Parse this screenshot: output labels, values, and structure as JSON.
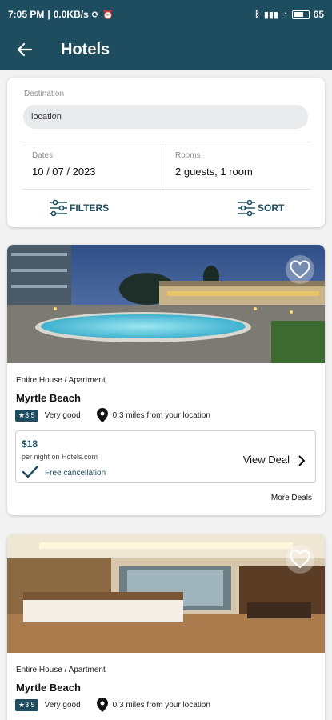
{
  "status_bar": {
    "time": "7:05 PM",
    "network_speed": "0.0KB/s",
    "battery": "65"
  },
  "app_bar": {
    "title": "Hotels",
    "back_icon": "arrow-left-icon"
  },
  "search": {
    "destination_label": "Destination",
    "destination_value": "location",
    "dates_label": "Dates",
    "dates_value": "10 / 07 / 2023",
    "rooms_label": "Rooms",
    "rooms_value": "2 guests, 1 room",
    "filters_label": "FILTERS",
    "sort_label": "SORT"
  },
  "colors": {
    "primary": "#1e4d5f",
    "background": "#f2f2f2"
  },
  "hotels": [
    {
      "type": "Entire House / Apartment",
      "name": "Myrtle Beach",
      "rating": "★3.5",
      "rating_text": "Very good",
      "distance": "0.3 miles from your location",
      "price": "$18",
      "price_sub": "per night on Hotels.com",
      "cancellation": "Free cancellation",
      "cta": "View Deal",
      "more": "More Deals"
    },
    {
      "type": "Entire House / Apartment",
      "name": "Myrtle Beach",
      "rating": "★3.5",
      "rating_text": "Very good",
      "distance": "0.3 miles from your location"
    }
  ]
}
